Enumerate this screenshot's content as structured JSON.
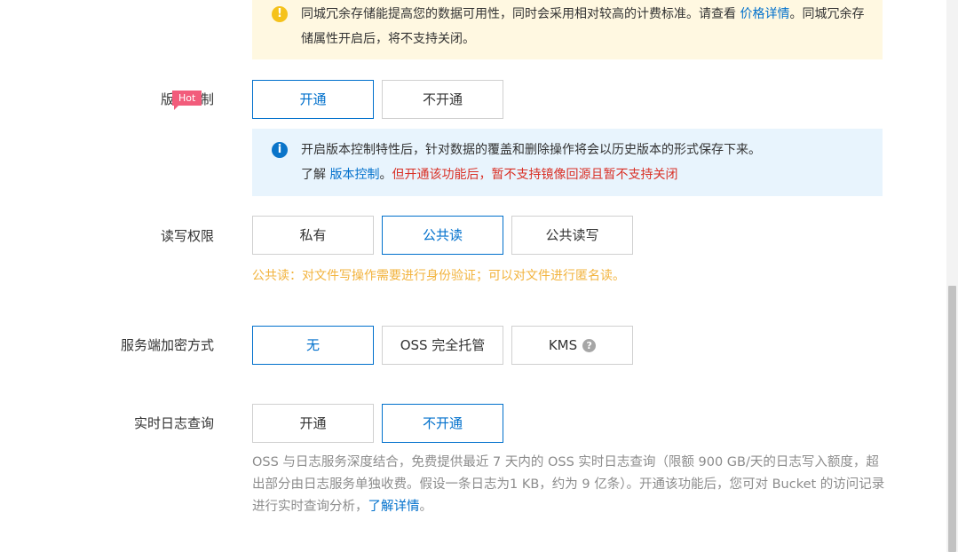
{
  "redundancy_notice": {
    "icon": "warning-icon",
    "text_before": "同城冗余存储能提高您的数据可用性，同时会采用相对较高的计费标准。请查看 ",
    "link": "价格详情",
    "text_after": "。同城冗余存储属性开启后，将不支持关闭。"
  },
  "versioning": {
    "label": "版本控制",
    "badge": "Hot",
    "options": [
      "开通",
      "不开通"
    ],
    "selected": "开通",
    "notice": {
      "icon": "info-icon",
      "line1": "开启版本控制特性后，针对数据的覆盖和删除操作将会以历史版本的形式保存下来。",
      "line2_prefix": "了解 ",
      "link": "版本控制",
      "line2_mid": "。",
      "warning": "但开通该功能后，暂不支持镜像回源且暂不支持关闭"
    }
  },
  "acl": {
    "label": "读写权限",
    "options": [
      "私有",
      "公共读",
      "公共读写"
    ],
    "selected": "公共读",
    "hint": "公共读：对文件写操作需要进行身份验证；可以对文件进行匿名读。"
  },
  "encryption": {
    "label": "服务端加密方式",
    "options": [
      "无",
      "OSS 完全托管",
      "KMS"
    ],
    "selected": "无"
  },
  "realtime_log": {
    "label": "实时日志查询",
    "options": [
      "开通",
      "不开通"
    ],
    "selected": "不开通",
    "help_text": "OSS 与日志服务深度结合，免费提供最近 7 天内的 OSS 实时日志查询（限额 900 GB/天的日志写入额度，超出部分由日志服务单独收费。假设一条日志为1 KB，约为 9 亿条）。开通该功能后，您可对 Bucket 的访问记录进行实时查询分析，",
    "link": "了解详情",
    "help_end": "。"
  },
  "colors": {
    "accent": "#0070cc",
    "hot_badge": "#f25c7b",
    "warning_bg": "#fff8e1",
    "info_bg": "#e8f4fd",
    "danger": "#d93026",
    "hint_orange": "#f2b33d"
  }
}
